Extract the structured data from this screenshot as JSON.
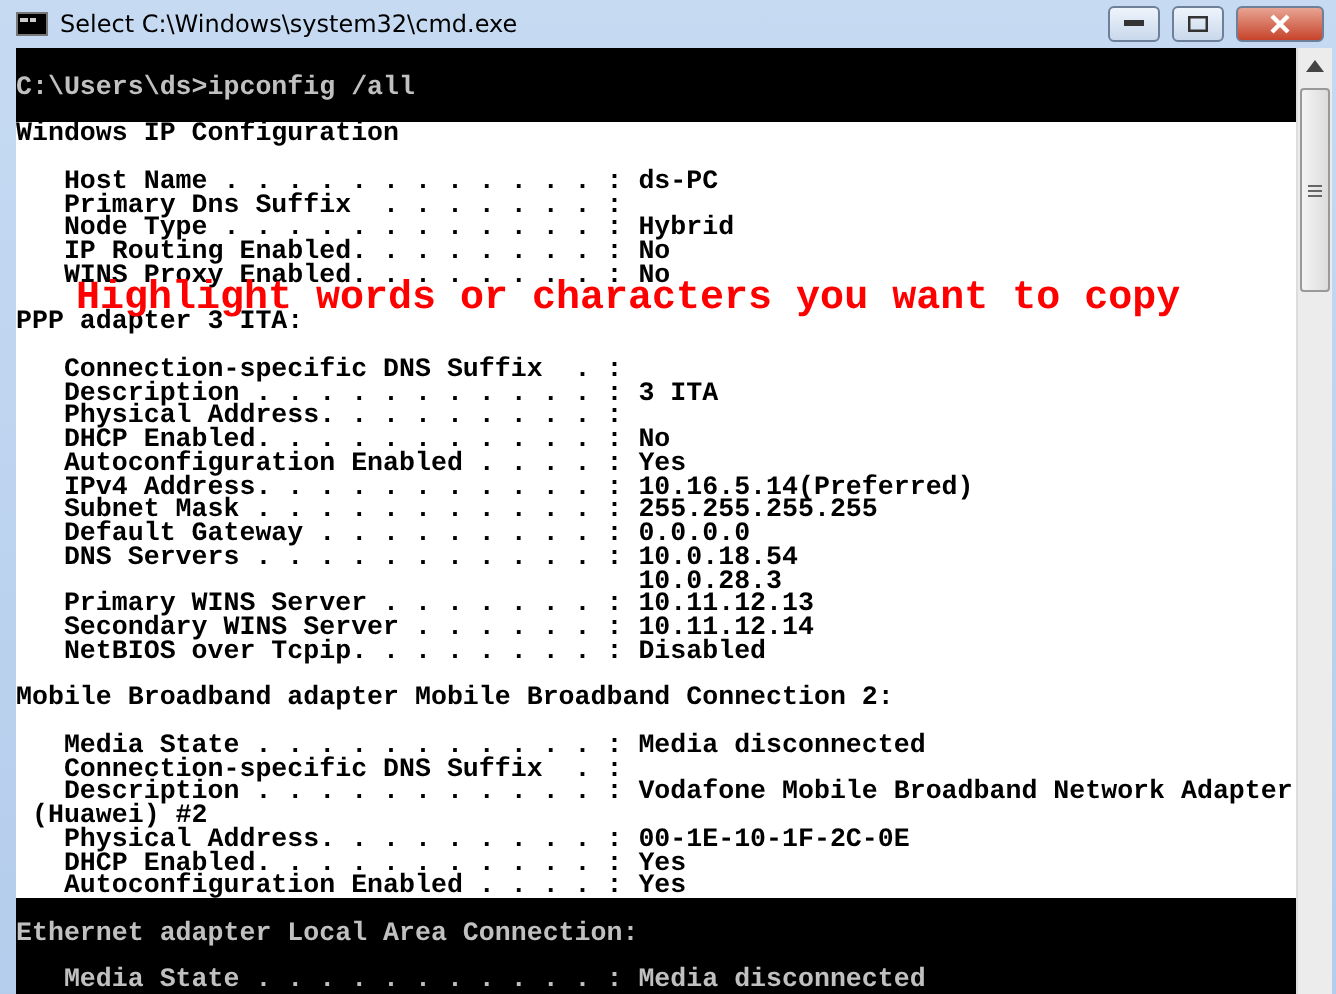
{
  "window": {
    "title": "Select C:\\Windows\\system32\\cmd.exe"
  },
  "console": {
    "lines": [
      {
        "kind": "blank",
        "selected": false
      },
      {
        "kind": "text",
        "text": "C:\\Users\\ds>ipconfig /all",
        "selected": false
      },
      {
        "kind": "blank",
        "selected": false
      },
      {
        "kind": "text",
        "text": "Windows IP Configuration",
        "selected": true
      },
      {
        "kind": "blank",
        "selected": true
      },
      {
        "kind": "text",
        "text": "   Host Name . . . . . . . . . . . . : ds-PC",
        "selected": true
      },
      {
        "kind": "text",
        "text": "   Primary Dns Suffix  . . . . . . . :",
        "selected": true
      },
      {
        "kind": "text",
        "text": "   Node Type . . . . . . . . . . . . : Hybrid",
        "selected": true
      },
      {
        "kind": "text",
        "text": "   IP Routing Enabled. . . . . . . . : No",
        "selected": true
      },
      {
        "kind": "text",
        "text": "   WINS Proxy Enabled. . . . . . . . : No",
        "selected": true
      },
      {
        "kind": "blank",
        "selected": true
      },
      {
        "kind": "text",
        "text": "PPP adapter 3 ITA:",
        "selected": true
      },
      {
        "kind": "blank",
        "selected": true
      },
      {
        "kind": "text",
        "text": "   Connection-specific DNS Suffix  . :",
        "selected": true
      },
      {
        "kind": "text",
        "text": "   Description . . . . . . . . . . . : 3 ITA",
        "selected": true
      },
      {
        "kind": "text",
        "text": "   Physical Address. . . . . . . . . :",
        "selected": true
      },
      {
        "kind": "text",
        "text": "   DHCP Enabled. . . . . . . . . . . : No",
        "selected": true
      },
      {
        "kind": "text",
        "text": "   Autoconfiguration Enabled . . . . : Yes",
        "selected": true
      },
      {
        "kind": "text",
        "text": "   IPv4 Address. . . . . . . . . . . : 10.16.5.14(Preferred)",
        "selected": true
      },
      {
        "kind": "text",
        "text": "   Subnet Mask . . . . . . . . . . . : 255.255.255.255",
        "selected": true
      },
      {
        "kind": "text",
        "text": "   Default Gateway . . . . . . . . . : 0.0.0.0",
        "selected": true
      },
      {
        "kind": "text",
        "text": "   DNS Servers . . . . . . . . . . . : 10.0.18.54",
        "selected": true
      },
      {
        "kind": "text",
        "text": "                                       10.0.28.3",
        "selected": true
      },
      {
        "kind": "text",
        "text": "   Primary WINS Server . . . . . . . : 10.11.12.13",
        "selected": true
      },
      {
        "kind": "text",
        "text": "   Secondary WINS Server . . . . . . : 10.11.12.14",
        "selected": true
      },
      {
        "kind": "text",
        "text": "   NetBIOS over Tcpip. . . . . . . . : Disabled",
        "selected": true
      },
      {
        "kind": "blank",
        "selected": true
      },
      {
        "kind": "text",
        "text": "Mobile Broadband adapter Mobile Broadband Connection 2:",
        "selected": true
      },
      {
        "kind": "blank",
        "selected": true
      },
      {
        "kind": "text",
        "text": "   Media State . . . . . . . . . . . : Media disconnected",
        "selected": true
      },
      {
        "kind": "text",
        "text": "   Connection-specific DNS Suffix  . :",
        "selected": true
      },
      {
        "kind": "text",
        "text": "   Description . . . . . . . . . . . : Vodafone Mobile Broadband Network Adapter",
        "selected": true
      },
      {
        "kind": "text",
        "text": " (Huawei) #2",
        "selected": true
      },
      {
        "kind": "text",
        "text": "   Physical Address. . . . . . . . . : 00-1E-10-1F-2C-0E",
        "selected": true
      },
      {
        "kind": "text",
        "text": "   DHCP Enabled. . . . . . . . . . . : Yes",
        "selected": true
      },
      {
        "kind": "text",
        "text": "   Autoconfiguration Enabled . . . . : Yes",
        "selected": true
      },
      {
        "kind": "blank",
        "selected": false
      },
      {
        "kind": "text",
        "text": "Ethernet adapter Local Area Connection:",
        "selected": false
      },
      {
        "kind": "blank",
        "selected": false
      },
      {
        "kind": "text",
        "text": "   Media State . . . . . . . . . . . : Media disconnected",
        "selected": false
      }
    ]
  },
  "annotation": {
    "text": "Highlight words or characters you want to copy"
  }
}
